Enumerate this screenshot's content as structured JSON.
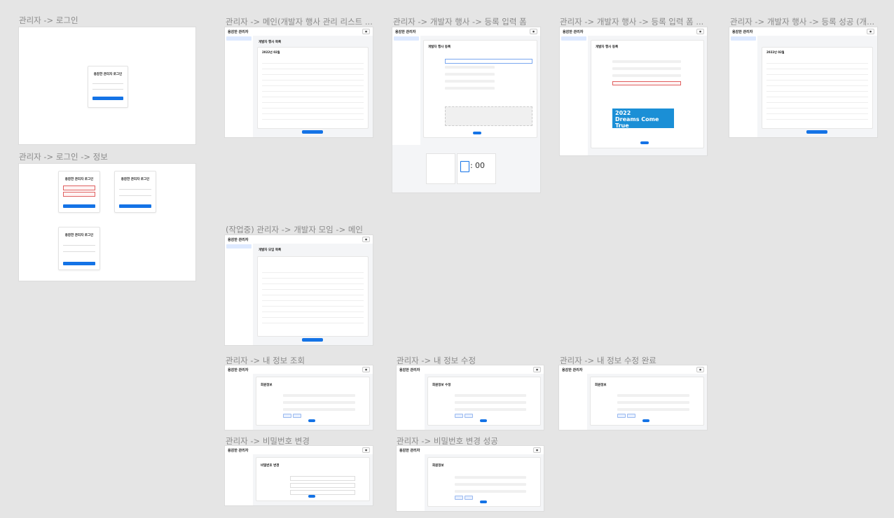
{
  "labels": {
    "login": "관리자 -> 로그인",
    "login_info": "관리자 -> 로그인 -> 정보",
    "main": "관리자 -> 메인(개발자 행사 관리 리스트 ...",
    "form": "관리자 -> 개발자 행사 -> 등록 입력 폼",
    "form2": "관리자 -> 개발자 행사 -> 등록 입력 폼 ...",
    "success": "관리자 -> 개발자 행사 -> 등록 성공 (개...",
    "meetup": "(작업중) 관리자 -> 개발자 모임 -> 메인",
    "myinfo": "관리자 -> 내 정보 조회",
    "myinfo_edit": "관리자 -> 내 정보 수정",
    "myinfo_done": "관리자 -> 내 정보 수정 완료",
    "pw": "관리자 -> 비밀번호 변경",
    "pw_done": "관리자 -> 비밀번호 변경 성공"
  },
  "brand": "용감한 관리자",
  "login_title": "용감한 관리자 로그인",
  "event_list_title": "개발자 행사 목록",
  "event_register_title": "개발자 행사 등록",
  "meetup_list_title": "개발자 모임 목록",
  "myinfo_title": "회원정보",
  "myinfo_edit_title": "회원정보 수정",
  "pw_title": "비밀번호 변경",
  "month_label": "2022년 02월",
  "dreams": {
    "year": "2022",
    "title": "Dreams Come True"
  },
  "time": {
    "hour": "",
    "sep": ":",
    "min": "00"
  }
}
